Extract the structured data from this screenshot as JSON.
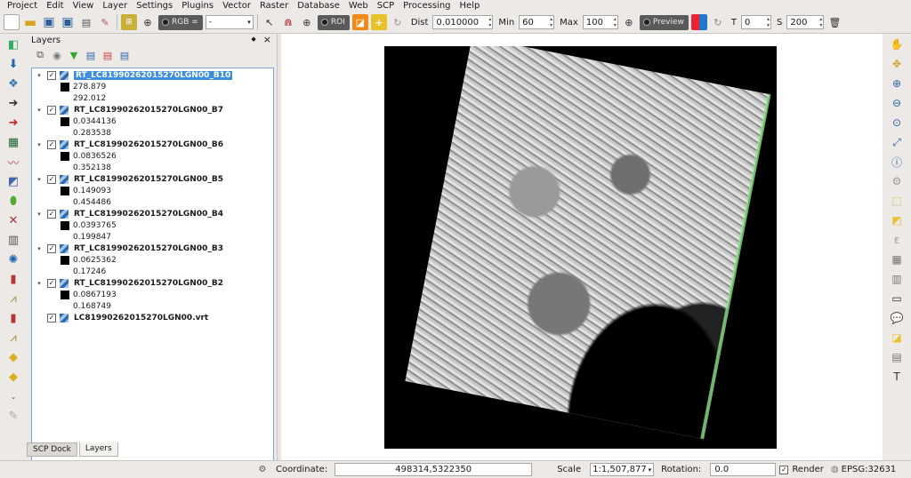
{
  "menu": [
    "Project",
    "Edit",
    "View",
    "Layer",
    "Settings",
    "Plugins",
    "Vector",
    "Raster",
    "Database",
    "Web",
    "SCP",
    "Processing",
    "Help"
  ],
  "toolbar": {
    "rgb_label": "RGB =",
    "band_combo_value": "-",
    "roi_label": "ROI",
    "dist_label": "Dist",
    "dist_value": "0.010000",
    "min_label": "Min",
    "min_value": "60",
    "max_label": "Max",
    "max_value": "100",
    "preview_label": "Preview",
    "t_label": "T",
    "t_value": "0",
    "s_label": "S",
    "s_value": "200"
  },
  "layers_panel": {
    "title": "Layers",
    "float_glyph": "◆",
    "close_glyph": "×",
    "layers": [
      {
        "name": "RT_LC81990262015270LGN00_B10",
        "min": "278.879",
        "max": "292.012",
        "selected": true
      },
      {
        "name": "RT_LC81990262015270LGN00_B7",
        "min": "0.0344136",
        "max": "0.283538",
        "selected": false
      },
      {
        "name": "RT_LC81990262015270LGN00_B6",
        "min": "0.0836526",
        "max": "0.352138",
        "selected": false
      },
      {
        "name": "RT_LC81990262015270LGN00_B5",
        "min": "0.149093",
        "max": "0.454486",
        "selected": false
      },
      {
        "name": "RT_LC81990262015270LGN00_B4",
        "min": "0.0393765",
        "max": "0.199847",
        "selected": false
      },
      {
        "name": "RT_LC81990262015270LGN00_B3",
        "min": "0.0625362",
        "max": "0.17246",
        "selected": false
      },
      {
        "name": "RT_LC81990262015270LGN00_B2",
        "min": "0.0867193",
        "max": "0.168749",
        "selected": false
      }
    ],
    "vrt_layer": "LC81990262015270LGN00.vrt"
  },
  "tabs": [
    "SCP Dock",
    "Layers"
  ],
  "status": {
    "coordinate_label": "Coordinate:",
    "coordinate_value": "498314,5322350",
    "scale_label": "Scale",
    "scale_value": "1:1,507,877",
    "rotation_label": "Rotation:",
    "rotation_value": "0.0",
    "render_label": "Render",
    "crs_label": "EPSG:32631"
  }
}
